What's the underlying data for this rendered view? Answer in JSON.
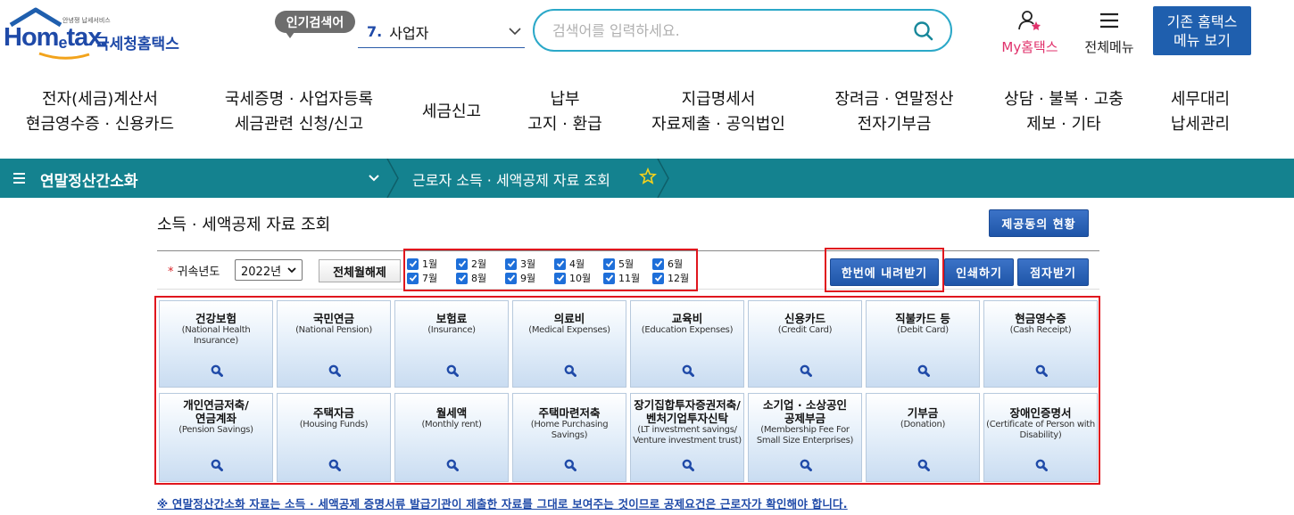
{
  "header": {
    "logo": {
      "small_text": "안녕쟁 납세서비스",
      "main_text": "Hom",
      "main_e": "e",
      "main_tail": "tax.",
      "korean": "국세청홈택스"
    },
    "popular_search": {
      "badge": "인기검색어",
      "rank": "7.",
      "term": "사업자"
    },
    "search": {
      "placeholder": "검색어를 입력하세요."
    },
    "my_hometax": "My홈택스",
    "all_menu": "전체메뉴",
    "old_menu": {
      "line1": "기존 홈택스",
      "line2": "메뉴 보기"
    }
  },
  "gnb": [
    {
      "line1": "전자(세금)계산서",
      "line2": "현금영수증 · 신용카드"
    },
    {
      "line1": "국세증명 · 사업자등록",
      "line2": "세금관련 신청/신고"
    },
    {
      "line1": "세금신고",
      "line2": ""
    },
    {
      "line1": "납부",
      "line2": "고지 · 환급"
    },
    {
      "line1": "지급명세서",
      "line2": "자료제출 · 공익법인"
    },
    {
      "line1": "장려금 · 연말정산",
      "line2": "전자기부금"
    },
    {
      "line1": "상담 · 불복 · 고충",
      "line2": "제보 · 기타"
    },
    {
      "line1": "세무대리",
      "line2": "납세관리"
    }
  ],
  "location": {
    "section": "연말정산간소화",
    "current": "근로자 소득 · 세액공제 자료 조회"
  },
  "content": {
    "title": "소득 · 세액공제 자료 조회",
    "status_button": "제공동의 현황",
    "year_label": "귀속년도",
    "year_value": "2022년",
    "uncheck_all": "전체월해제",
    "months": [
      "1월",
      "2월",
      "3월",
      "4월",
      "5월",
      "6월",
      "7월",
      "8월",
      "9월",
      "10월",
      "11월",
      "12월"
    ],
    "download_all": "한번에 내려받기",
    "print": "인쇄하기",
    "receive": "점자받기",
    "cards": [
      {
        "ko": "건강보험",
        "en": "(National Health\nInsurance)"
      },
      {
        "ko": "국민연금",
        "en": "(National Pension)"
      },
      {
        "ko": "보험료",
        "en": "(Insurance)"
      },
      {
        "ko": "의료비",
        "en": "(Medical Expenses)"
      },
      {
        "ko": "교육비",
        "en": "(Education Expenses)"
      },
      {
        "ko": "신용카드",
        "en": "(Credit Card)"
      },
      {
        "ko": "직불카드 등",
        "en": "(Debit Card)"
      },
      {
        "ko": "현금영수증",
        "en": "(Cash Receipt)"
      },
      {
        "ko": "개인연금저축/\n연금계좌",
        "en": "(Pension Savings)"
      },
      {
        "ko": "주택자금",
        "en": "(Housing Funds)"
      },
      {
        "ko": "월세액",
        "en": "(Monthly rent)"
      },
      {
        "ko": "주택마련저축",
        "en": "(Home Purchasing Savings)"
      },
      {
        "ko": "장기집합투자증권저축/\n벤처기업투자신탁",
        "en": "(LT investment savings/\nVenture investment trust)"
      },
      {
        "ko": "소기업 · 소상공인\n공제부금",
        "en": "(Membership Fee For\nSmall Size Enterprises)"
      },
      {
        "ko": "기부금",
        "en": "(Donation)"
      },
      {
        "ko": "장애인증명서",
        "en": "(Certificate of Person with\nDisability)"
      }
    ],
    "notice": "※ 연말정산간소화 자료는 소득 · 세액공제 증명서류 발급기관이 제출한 자료를 그대로 보여주는 것이므로 공제요건은 근로자가 확인해야 합니다."
  },
  "colors": {
    "brand_blue": "#1f5fae",
    "teal_bar": "#14828f",
    "highlight_red": "#e0161e",
    "checkbox_blue": "#1e6fd9"
  }
}
